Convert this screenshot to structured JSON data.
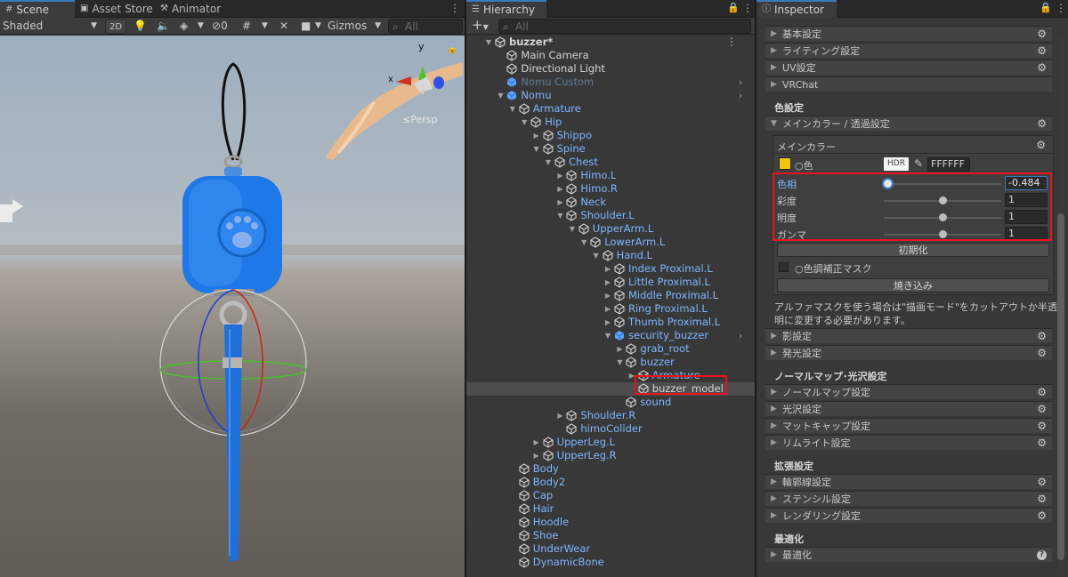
{
  "scene": {
    "tabs": [
      "Scene",
      "Asset Store",
      "Animator"
    ],
    "shading_mode": "Shaded",
    "mode_2d": "2D",
    "hidden_count": "0",
    "gizmos_label": "Gizmos",
    "search_placeholder": "All",
    "persp_label": "Persp",
    "axis_y": "y",
    "axis_x": "x"
  },
  "hierarchy": {
    "tab_label": "Hierarchy",
    "add_label": "+",
    "search_placeholder": "All",
    "rows": [
      {
        "label": "buzzer*",
        "depth": 0,
        "arrow": "down",
        "icon": "scene",
        "style": "white"
      },
      {
        "label": "Main Camera",
        "depth": 1,
        "arrow": "",
        "icon": "cube",
        "style": "white"
      },
      {
        "label": "Directional Light",
        "depth": 1,
        "arrow": "",
        "icon": "cube",
        "style": "white"
      },
      {
        "label": "Nomu Custom",
        "depth": 1,
        "arrow": "",
        "icon": "prefab",
        "style": "dim",
        "more": true
      },
      {
        "label": "Nomu",
        "depth": 1,
        "arrow": "down",
        "icon": "prefab",
        "style": "blue",
        "more": true
      },
      {
        "label": "Armature",
        "depth": 2,
        "arrow": "down",
        "icon": "cube",
        "style": "blue"
      },
      {
        "label": "Hip",
        "depth": 3,
        "arrow": "down",
        "icon": "cube",
        "style": "blue"
      },
      {
        "label": "Shippo",
        "depth": 4,
        "arrow": "right",
        "icon": "cube",
        "style": "blue"
      },
      {
        "label": "Spine",
        "depth": 4,
        "arrow": "down",
        "icon": "cube",
        "style": "blue"
      },
      {
        "label": "Chest",
        "depth": 5,
        "arrow": "down",
        "icon": "cube",
        "style": "blue"
      },
      {
        "label": "Himo.L",
        "depth": 6,
        "arrow": "right",
        "icon": "cube",
        "style": "blue"
      },
      {
        "label": "Himo.R",
        "depth": 6,
        "arrow": "right",
        "icon": "cube",
        "style": "blue"
      },
      {
        "label": "Neck",
        "depth": 6,
        "arrow": "right",
        "icon": "cube",
        "style": "blue"
      },
      {
        "label": "Shoulder.L",
        "depth": 6,
        "arrow": "down",
        "icon": "cube",
        "style": "blue"
      },
      {
        "label": "UpperArm.L",
        "depth": 7,
        "arrow": "down",
        "icon": "cube",
        "style": "blue"
      },
      {
        "label": "LowerArm.L",
        "depth": 8,
        "arrow": "down",
        "icon": "cube",
        "style": "blue"
      },
      {
        "label": "Hand.L",
        "depth": 9,
        "arrow": "down",
        "icon": "cube",
        "style": "blue"
      },
      {
        "label": "Index Proximal.L",
        "depth": 10,
        "arrow": "right",
        "icon": "cube",
        "style": "blue"
      },
      {
        "label": "Little Proximal.L",
        "depth": 10,
        "arrow": "right",
        "icon": "cube",
        "style": "blue"
      },
      {
        "label": "Middle Proximal.L",
        "depth": 10,
        "arrow": "right",
        "icon": "cube",
        "style": "blue"
      },
      {
        "label": "Ring Proximal.L",
        "depth": 10,
        "arrow": "right",
        "icon": "cube",
        "style": "blue"
      },
      {
        "label": "Thumb Proximal.L",
        "depth": 10,
        "arrow": "right",
        "icon": "cube",
        "style": "blue"
      },
      {
        "label": "security_buzzer",
        "depth": 10,
        "arrow": "down",
        "icon": "prefab",
        "style": "blue",
        "more": true
      },
      {
        "label": "grab_root",
        "depth": 11,
        "arrow": "right",
        "icon": "cube",
        "style": "blue"
      },
      {
        "label": "buzzer",
        "depth": 11,
        "arrow": "down",
        "icon": "cube",
        "style": "blue"
      },
      {
        "label": "Armature",
        "depth": 12,
        "arrow": "right",
        "icon": "cube",
        "style": "blue"
      },
      {
        "label": "buzzer_model",
        "depth": 12,
        "arrow": "",
        "icon": "cube",
        "style": "white",
        "selected": true
      },
      {
        "label": "sound",
        "depth": 11,
        "arrow": "",
        "icon": "cube",
        "style": "blue"
      },
      {
        "label": "Shoulder.R",
        "depth": 6,
        "arrow": "right",
        "icon": "cube",
        "style": "blue"
      },
      {
        "label": "himoColider",
        "depth": 6,
        "arrow": "",
        "icon": "cube",
        "style": "blue"
      },
      {
        "label": "UpperLeg.L",
        "depth": 4,
        "arrow": "right",
        "icon": "cube",
        "style": "blue"
      },
      {
        "label": "UpperLeg.R",
        "depth": 4,
        "arrow": "right",
        "icon": "cube",
        "style": "blue"
      },
      {
        "label": "Body",
        "depth": 2,
        "arrow": "",
        "icon": "cube",
        "style": "blue"
      },
      {
        "label": "Body2",
        "depth": 2,
        "arrow": "",
        "icon": "cube",
        "style": "blue"
      },
      {
        "label": "Cap",
        "depth": 2,
        "arrow": "",
        "icon": "cube",
        "style": "blue"
      },
      {
        "label": "Hair",
        "depth": 2,
        "arrow": "",
        "icon": "cube",
        "style": "blue"
      },
      {
        "label": "Hoodle",
        "depth": 2,
        "arrow": "",
        "icon": "cube",
        "style": "blue"
      },
      {
        "label": "Shoe",
        "depth": 2,
        "arrow": "",
        "icon": "cube",
        "style": "blue"
      },
      {
        "label": "UnderWear",
        "depth": 2,
        "arrow": "",
        "icon": "cube",
        "style": "blue"
      },
      {
        "label": "DynamicBone",
        "depth": 2,
        "arrow": "",
        "icon": "cube",
        "style": "blue"
      }
    ]
  },
  "inspector": {
    "tab_label": "Inspector",
    "top_foldouts": [
      "基本設定",
      "ライティング設定",
      "UV設定",
      "VRChat"
    ],
    "color_section_title": "色設定",
    "main_color_foldout": "メインカラー / 透過設定",
    "main_color_box_title": "メインカラー",
    "color_label": "色",
    "hdr_label": "HDR",
    "color_hex": "FFFFFF",
    "hsv_rows": [
      {
        "label": "色相",
        "value": "-0.484",
        "position": 0.03,
        "active": true
      },
      {
        "label": "彩度",
        "value": "1",
        "position": 0.5,
        "active": false
      },
      {
        "label": "明度",
        "value": "1",
        "position": 0.5,
        "active": false
      },
      {
        "label": "ガンマ",
        "value": "1",
        "position": 0.5,
        "active": false
      }
    ],
    "reset_button": "初期化",
    "mask_label": "色調補正マスク",
    "bake_button": "焼き込み",
    "alpha_note": "アルファマスクを使う場合は\"描画モード\"をカットアウトか半透明に変更する必要があります。",
    "shadow_foldout": "影設定",
    "emission_foldout": "発光設定",
    "normal_section_title": "ノーマルマップ･光沢設定",
    "normal_foldouts": [
      "ノーマルマップ設定",
      "光沢設定",
      "マットキャップ設定",
      "リムライト設定"
    ],
    "extend_section_title": "拡張設定",
    "extend_foldouts": [
      "輪郭線設定",
      "ステンシル設定",
      "レンダリング設定"
    ],
    "optimize_section_title": "最適化",
    "optimize_foldout": "最適化",
    "help_icon": "?"
  },
  "colors": {
    "accent": "#3a79bb",
    "highlight_red": "#e8141c",
    "hierarchy_blue": "#7eb6ff",
    "buzzer_blue": "#1f78e8"
  }
}
